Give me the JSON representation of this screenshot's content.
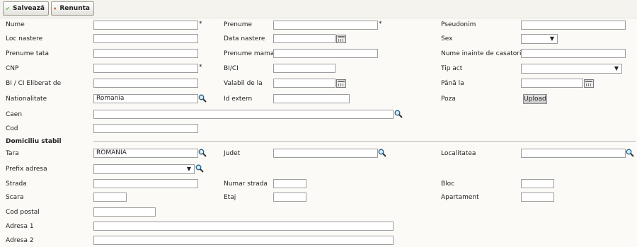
{
  "toolbar": {
    "save_label": "Salvează",
    "cancel_label": "Renunta"
  },
  "labels": {
    "nume": "Nume",
    "prenume": "Prenume",
    "pseudonim": "Pseudonim",
    "loc_nastere": "Loc nastere",
    "data_nastere": "Data nastere",
    "sex": "Sex",
    "prenume_tata": "Prenume tata",
    "prenume_mama": "Prenume mama",
    "nume_casatorie": "Nume inainte de casatorie",
    "cnp": "CNP",
    "bici": "BI/CI",
    "tip_act": "Tip act",
    "bici_eliberat": "BI / CI Eliberat de",
    "valabil": "Valabil de la",
    "pana_la": "Până la",
    "nationalitate": "Nationalitate",
    "id_extern": "Id extern",
    "poza": "Poza",
    "caen": "Caen",
    "cod": "Cod",
    "tara": "Tara",
    "judet": "Judet",
    "localitatea": "Localitatea",
    "prefix_adresa": "Prefix adresa",
    "strada": "Strada",
    "numar_strada": "Numar strada",
    "bloc": "Bloc",
    "scara": "Scara",
    "etaj": "Etaj",
    "apartament": "Apartament",
    "cod_postal": "Cod postal",
    "adresa1": "Adresa 1",
    "adresa2": "Adresa 2"
  },
  "required_marker": "*",
  "values": {
    "nationalitate": "Romania",
    "tara": "ROMANIA"
  },
  "section_title": "Domiciliu stabil",
  "upload_label": "Upload",
  "icons": {
    "save": "checkmark-icon",
    "cancel": "cancel-icon",
    "search": "magnifier-icon",
    "calendar": "calendar-icon"
  },
  "colors": {
    "save_check": "#3fa82c",
    "cancel_circle": "#e5541c",
    "background": "#fbfaf6"
  }
}
